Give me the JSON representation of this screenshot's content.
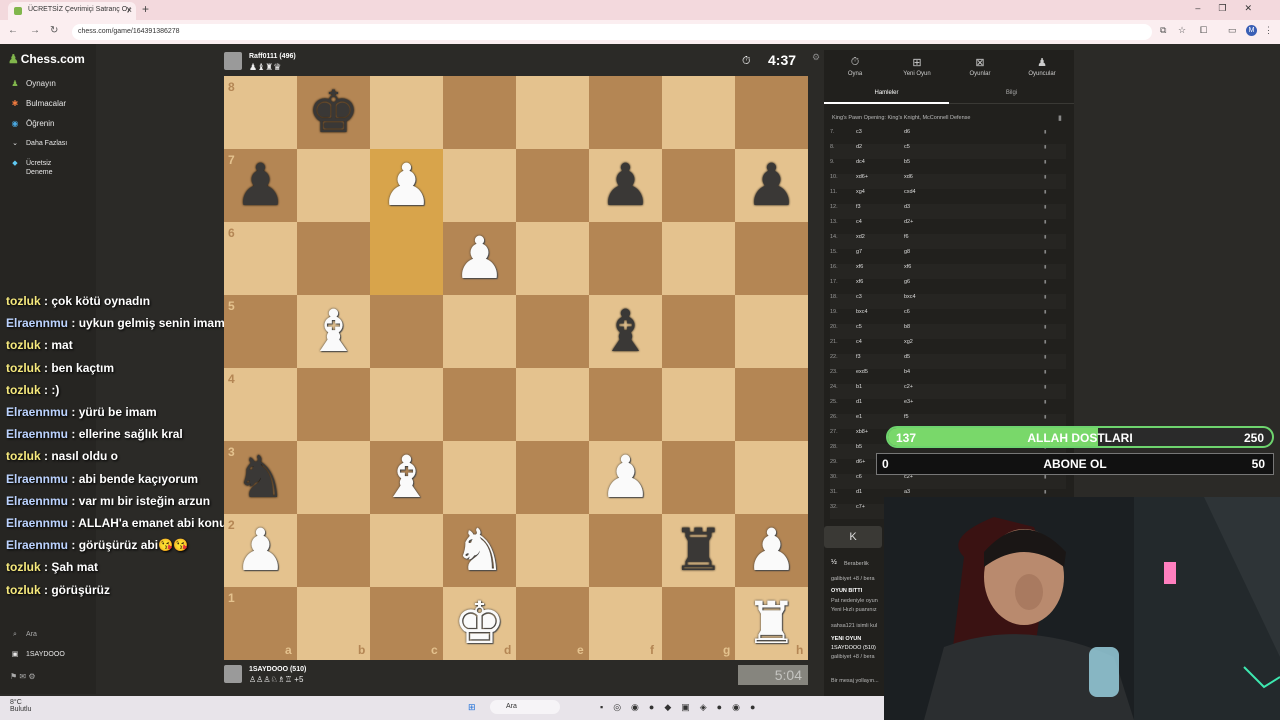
{
  "browser": {
    "tab_title": "ÜCRETSİZ Çevrimiçi Satranç Oy",
    "url": "chess.com/game/164391386278"
  },
  "sidebar": {
    "logo": "Chess.com",
    "items": [
      {
        "label": "Oynayın",
        "icon": "play-icon"
      },
      {
        "label": "Bulmacalar",
        "icon": "puzzle-icon"
      },
      {
        "label": "Öğrenin",
        "icon": "learn-icon"
      },
      {
        "label": "Daha Fazlası",
        "icon": "chevron-down-icon"
      },
      {
        "label": "Ücretsiz",
        "icon": "diamond-icon"
      },
      {
        "label": "Deneme",
        "icon": ""
      }
    ],
    "search": "Ara",
    "user": "1SAYDOOO"
  },
  "chat": [
    {
      "user": "tozluk",
      "msg": ": çok kötü oynadın"
    },
    {
      "user": "Elraennmu",
      "msg": ": uykun gelmiş senin imam"
    },
    {
      "user": "tozluk",
      "msg": ": mat"
    },
    {
      "user": "tozluk",
      "msg": ": ben kaçtım"
    },
    {
      "user": "tozluk",
      "msg": ": :)"
    },
    {
      "user": "Elraennmu",
      "msg": ": yürü be imam"
    },
    {
      "user": "Elraennmu",
      "msg": ": ellerine sağlık kral"
    },
    {
      "user": "tozluk",
      "msg": ": nasıl oldu o"
    },
    {
      "user": "Elraennmu",
      "msg": ": abi bende kaçıyorum"
    },
    {
      "user": "Elraennmu",
      "msg": ": var mı bir isteğin arzun"
    },
    {
      "user": "Elraennmu",
      "msg": ": ALLAH'a emanet abi konuşuruz kral bi görüşeyim de😍😍"
    },
    {
      "user": "Elraennmu",
      "msg": ": görüşürüz abi😘😘"
    },
    {
      "user": "tozluk",
      "msg": ": Şah mat"
    },
    {
      "user": "tozluk",
      "msg": ": görüşürüz"
    }
  ],
  "players": {
    "top": {
      "name": "Raff0111 (496)",
      "clock": "4:37"
    },
    "bottom": {
      "name": "1SAYDOOO (510)",
      "clock": "5:04",
      "material": "+5"
    }
  },
  "board": {
    "ranks": [
      "8",
      "7",
      "6",
      "5",
      "4",
      "3",
      "2",
      "1"
    ],
    "files": [
      "a",
      "b",
      "c",
      "d",
      "e",
      "f",
      "g",
      "h"
    ],
    "pieces": [
      {
        "sq": "b8",
        "p": "♚",
        "c": "black"
      },
      {
        "sq": "a7",
        "p": "♟",
        "c": "black"
      },
      {
        "sq": "c7",
        "p": "♟",
        "c": "white"
      },
      {
        "sq": "f7",
        "p": "♟",
        "c": "black"
      },
      {
        "sq": "h7",
        "p": "♟",
        "c": "black"
      },
      {
        "sq": "d6",
        "p": "♟",
        "c": "white"
      },
      {
        "sq": "b5",
        "p": "♝",
        "c": "white"
      },
      {
        "sq": "f5",
        "p": "♝",
        "c": "black"
      },
      {
        "sq": "a3",
        "p": "♞",
        "c": "black"
      },
      {
        "sq": "c3",
        "p": "♝",
        "c": "white"
      },
      {
        "sq": "f3",
        "p": "♟",
        "c": "white"
      },
      {
        "sq": "a2",
        "p": "♟",
        "c": "white"
      },
      {
        "sq": "d2",
        "p": "♞",
        "c": "white"
      },
      {
        "sq": "g2",
        "p": "♜",
        "c": "black"
      },
      {
        "sq": "h2",
        "p": "♟",
        "c": "white"
      },
      {
        "sq": "d1",
        "p": "♚",
        "c": "white"
      },
      {
        "sq": "h1",
        "p": "♜",
        "c": "white"
      }
    ],
    "highlight": [
      "c7",
      "c6"
    ]
  },
  "panel": {
    "tabs": [
      {
        "label": "Oyna",
        "icon": "clock-icon"
      },
      {
        "label": "Yeni Oyun",
        "icon": "plus-icon"
      },
      {
        "label": "Oyunlar",
        "icon": "grid-icon"
      },
      {
        "label": "Oyuncular",
        "icon": "users-icon"
      }
    ],
    "subtabs": [
      "Hamleler",
      "Bilgi"
    ],
    "opening": "King's Pawn Opening: King's Knight, McConnell Defense",
    "moves": [
      [
        "7.",
        "c3",
        "d6"
      ],
      [
        "8.",
        "d2",
        "c5"
      ],
      [
        "9.",
        "dc4",
        "b5"
      ],
      [
        "10.",
        "xd6+",
        "xd6"
      ],
      [
        "11.",
        "xg4",
        "cxd4"
      ],
      [
        "12.",
        "f3",
        "d3"
      ],
      [
        "13.",
        "c4",
        "d2+"
      ],
      [
        "14.",
        "xd2",
        "f6"
      ],
      [
        "15.",
        "g7",
        "g8"
      ],
      [
        "16.",
        "xf6",
        "xf6"
      ],
      [
        "17.",
        "xf6",
        "g6"
      ],
      [
        "18.",
        "c3",
        "bxc4"
      ],
      [
        "19.",
        "bxc4",
        "c6"
      ],
      [
        "20.",
        "c5",
        "b8"
      ],
      [
        "21.",
        "c4",
        "xg2"
      ],
      [
        "22.",
        "f3",
        "d5"
      ],
      [
        "23.",
        "exd5",
        "b4"
      ],
      [
        "24.",
        "b1",
        "c2+"
      ],
      [
        "25.",
        "d1",
        "e3+"
      ],
      [
        "26.",
        "e1",
        "f5"
      ],
      [
        "27.",
        "xb8+",
        ""
      ],
      [
        "28.",
        "b5",
        ""
      ],
      [
        "29.",
        "d6+",
        "xb8"
      ],
      [
        "30.",
        "c6",
        "c2+"
      ],
      [
        "31.",
        "d1",
        "a3"
      ],
      [
        "32.",
        "c7+",
        ""
      ]
    ],
    "result_lines": [
      "Beraberlik",
      "galibiyet +8 / bera",
      "OYUN BİTTİ",
      "Pat nedeniyle oyun",
      "Yeni Hızlı puanınız",
      "sahsa121 isimli kul",
      "YENİ OYUN",
      "1SAYDOOO (510)",
      "galibiyet +8 / bera",
      "Bir mesaj yollayın..."
    ]
  },
  "overlays": {
    "goal1": {
      "current": "137",
      "label": "ALLAH DOSTLARI",
      "target": "250",
      "progress": 0.548
    },
    "goal2": {
      "current": "0",
      "label": "ABONE OL",
      "target": "50",
      "progress": 0
    }
  },
  "taskbar": {
    "weather": "8°C",
    "weather_sub": "Bulutlu",
    "search": "Ara"
  }
}
